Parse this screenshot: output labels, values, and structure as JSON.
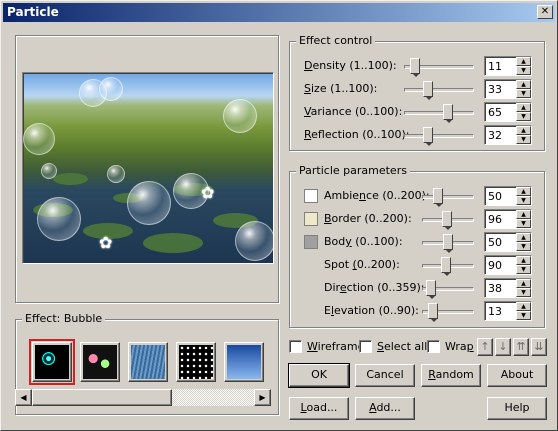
{
  "window": {
    "title": "Particle",
    "close_glyph": "✕"
  },
  "effect_control": {
    "legend": "Effect control",
    "rows": [
      {
        "label_u": "D",
        "label": "ensity (1..100):",
        "value": "11",
        "fraction": 0.1
      },
      {
        "label_u": "S",
        "label": "ize (1..100):",
        "value": "33",
        "fraction": 0.32
      },
      {
        "label_u": "V",
        "label": "ariance (0..100):",
        "value": "65",
        "fraction": 0.65
      },
      {
        "label_u": "R",
        "label": "eflection (0..100):",
        "value": "32",
        "fraction": 0.32
      }
    ]
  },
  "particle_params": {
    "legend": "Particle parameters",
    "rows": [
      {
        "label_u": "",
        "label": "Ambie",
        "label_u2": "n",
        "label_rest": "ce (0..200):",
        "value": "50",
        "fraction": 0.25,
        "swatch": "#ffffff"
      },
      {
        "label_u": "B",
        "label": "",
        "label_u2": "",
        "label_rest": "order (0..200):",
        "value": "96",
        "fraction": 0.48,
        "swatch": "#ede8c8"
      },
      {
        "label_u": "",
        "label": "Bod",
        "label_u2": "y",
        "label_rest": " (0..100):",
        "value": "50",
        "fraction": 0.5,
        "swatch": "#a0a0a0"
      },
      {
        "label_u": "",
        "label": "Spot ",
        "label_u2": "(",
        "label_rest": "0..200):",
        "value": "90",
        "fraction": 0.45,
        "swatch": ""
      },
      {
        "label_u": "",
        "label": "Dir",
        "label_u2": "e",
        "label_rest": "ction (0..359):",
        "value": "38",
        "fraction": 0.1,
        "swatch": ""
      },
      {
        "label_u": "",
        "label": "E",
        "label_u2": "l",
        "label_rest": "evation (0..90):",
        "value": "13",
        "fraction": 0.14,
        "swatch": ""
      }
    ]
  },
  "options": {
    "wireframe_u": "W",
    "wireframe": "ireframe",
    "select_all_u": "S",
    "select_all": "elect all",
    "wrap_pre": "Wra",
    "wrap_u": "p"
  },
  "arrows": {
    "up": "↑",
    "down": "↓",
    "top": "⇈",
    "bottom": "⇊"
  },
  "buttons": {
    "ok": "OK",
    "cancel": "Cancel",
    "random_u": "R",
    "random": "andom",
    "about": "About",
    "load_u": "L",
    "load": "oad...",
    "add_u": "A",
    "add": "dd...",
    "help": "Help"
  },
  "effect": {
    "legend": "Effect: Bubble",
    "selected_index": 0
  },
  "scrollbar": {
    "left": "◀",
    "right": "▶"
  },
  "colors": {
    "selection_outline": "#d02020",
    "titlebar_start": "#0a246a",
    "titlebar_end": "#a6caf0"
  }
}
